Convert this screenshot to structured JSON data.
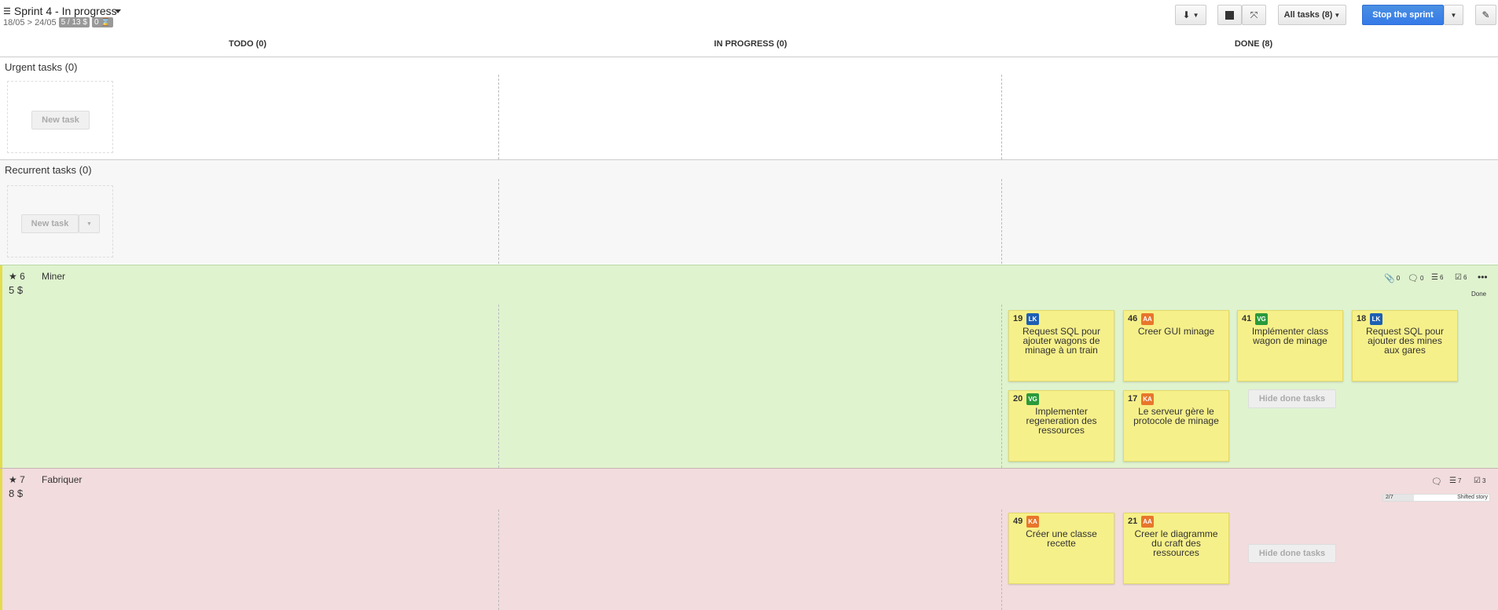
{
  "sprint": {
    "title": "Sprint 4 - In progress",
    "dates": "18/05 > 24/05",
    "points_badge": "5 / 13 $",
    "time_badge": "0 ⌛"
  },
  "toolbar": {
    "download_icon": "download-icon",
    "all_tasks_label": "All tasks (8)",
    "stop_sprint_label": "Stop the sprint"
  },
  "columns": [
    {
      "label": "TODO (0)"
    },
    {
      "label": "IN PROGRESS (0)"
    },
    {
      "label": "DONE (8)"
    }
  ],
  "lanes": {
    "urgent": {
      "title": "Urgent tasks (0)",
      "new_task": "New task"
    },
    "recurrent": {
      "title": "Recurrent tasks (0)",
      "new_task": "New task"
    }
  },
  "stories": [
    {
      "rank": "6",
      "points": "5 $",
      "name": "Miner",
      "metrics": {
        "attachments": "0",
        "comments": "0",
        "tasks": "6",
        "checks": "6"
      },
      "state": "Done",
      "hide_done_label": "Hide done tasks",
      "cards": [
        {
          "num": "19",
          "avatar": "LK",
          "color": "#1e5fb4",
          "text": "Request SQL pour ajouter wagons de minage à un train"
        },
        {
          "num": "46",
          "avatar": "AA",
          "color": "#e8762b",
          "text": "Creer GUI minage"
        },
        {
          "num": "41",
          "avatar": "VG",
          "color": "#2a9a3b",
          "text": "Implémenter class wagon de minage"
        },
        {
          "num": "18",
          "avatar": "LK",
          "color": "#1e5fb4",
          "text": "Request SQL pour ajouter des mines aux gares"
        },
        {
          "num": "20",
          "avatar": "VG",
          "color": "#2a9a3b",
          "text": "Implementer regeneration des ressources"
        },
        {
          "num": "17",
          "avatar": "KA",
          "color": "#e8762b",
          "text": "Le serveur gère le protocole de minage"
        }
      ]
    },
    {
      "rank": "7",
      "points": "8 $",
      "name": "Fabriquer",
      "metrics": {
        "tasks": "7",
        "checks": "3"
      },
      "progress_text": "2/7",
      "progress": 0.2857,
      "state": "Shifted story",
      "hide_done_label": "Hide done tasks",
      "cards": [
        {
          "num": "49",
          "avatar": "KA",
          "color": "#e8762b",
          "text": "Créer une classe recette"
        },
        {
          "num": "21",
          "avatar": "AA",
          "color": "#e8762b",
          "text": "Creer le diagramme du craft des ressources"
        }
      ]
    }
  ]
}
